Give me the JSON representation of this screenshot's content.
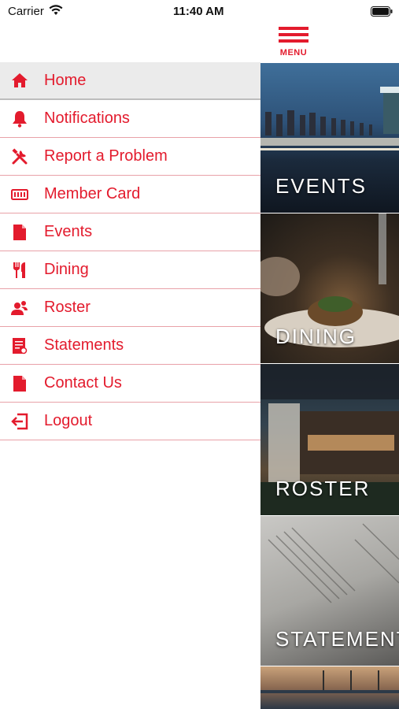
{
  "status_bar": {
    "carrier": "Carrier",
    "time": "11:40 AM"
  },
  "header": {
    "menu_label": "MENU"
  },
  "drawer": {
    "items": [
      {
        "label": "Home",
        "icon": "home-icon",
        "active": true
      },
      {
        "label": "Notifications",
        "icon": "bell-icon"
      },
      {
        "label": "Report a Problem",
        "icon": "tools-icon"
      },
      {
        "label": "Member Card",
        "icon": "card-icon"
      },
      {
        "label": "Events",
        "icon": "document-icon"
      },
      {
        "label": "Dining",
        "icon": "fork-knife-icon"
      },
      {
        "label": "Roster",
        "icon": "users-icon"
      },
      {
        "label": "Statements",
        "icon": "statement-icon"
      },
      {
        "label": "Contact Us",
        "icon": "document-icon"
      },
      {
        "label": "Logout",
        "icon": "logout-icon"
      }
    ]
  },
  "tiles": [
    {
      "label": "EVENTS"
    },
    {
      "label": "DINING"
    },
    {
      "label": "ROSTER"
    },
    {
      "label": "STATEMENTS"
    }
  ],
  "colors": {
    "accent": "#e31b2d",
    "divider": "#e8a1a8",
    "active_bg": "#ebebeb"
  }
}
